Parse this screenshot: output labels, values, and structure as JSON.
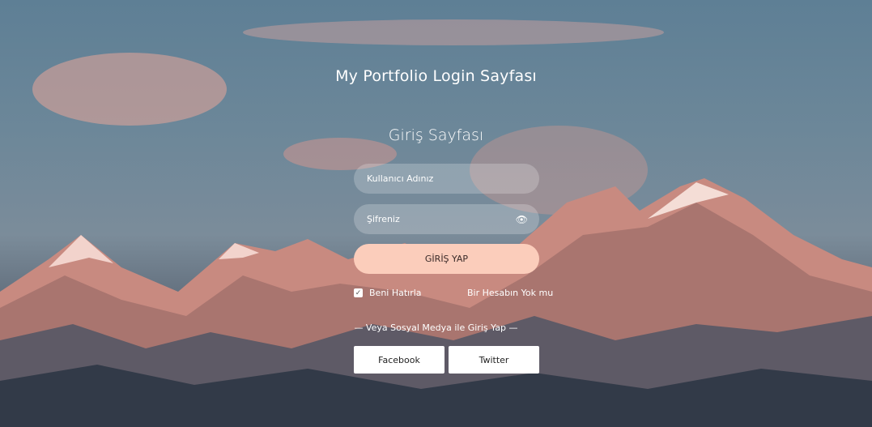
{
  "header": {
    "title": "My Portfolio Login Sayfası"
  },
  "form": {
    "title": "Giriş Sayfası",
    "username_placeholder": "Kullanıcı Adınız",
    "password_placeholder": "Şifreniz",
    "eye_icon": "👁",
    "login_label": "GİRİŞ YAP",
    "remember_label": "Beni Hatırla",
    "checkbox_mark": "✓",
    "no_account_label": "Bir Hesabın Yok mu",
    "social_text": "— Veya Sosyal Medya ile Giriş Yap —",
    "facebook_label": "Facebook",
    "twitter_label": "Twitter"
  },
  "colors": {
    "button_accent": "#fbcdbb",
    "mountain_glow": "#d98a78"
  }
}
